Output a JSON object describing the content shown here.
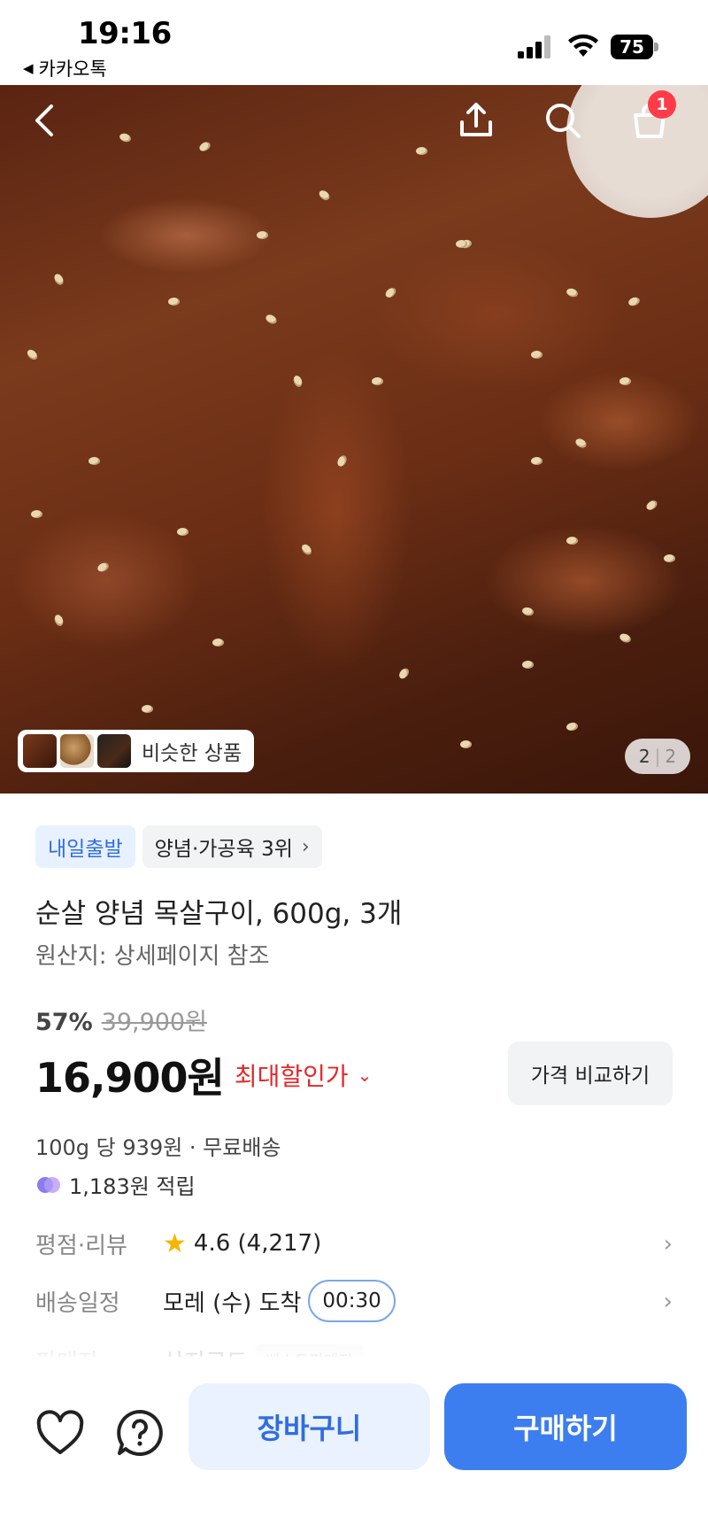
{
  "status_bar": {
    "time": "19:16",
    "back_app": "카카오톡",
    "battery": "75"
  },
  "hero": {
    "similar_label": "비슷한 상품",
    "page_current": "2",
    "page_total": "2",
    "cart_badge": "1"
  },
  "product": {
    "tag_shipping": "내일출발",
    "tag_ranking": "양념·가공육 3위",
    "title": "순살 양념 목살구이, 600g, 3개",
    "origin": "원산지: 상세페이지 참조",
    "discount": "57%",
    "original_price": "39,900원",
    "price": "16,900원",
    "max_discount_label": "최대할인가",
    "compare_label": "가격 비교하기",
    "unit_price": "100g 당 939원 · 무료배송",
    "points": "1,183원 적립"
  },
  "meta": {
    "rating_label": "평점·리뷰",
    "rating_value": "4.6 (4,217)",
    "delivery_label": "배송일정",
    "delivery_value": "모레 (수) 도착",
    "delivery_timer": "00:30",
    "seller_label": "판매자",
    "seller_value": "상지로드",
    "seller_badge": "베스트판매자"
  },
  "bottom": {
    "cart_label": "장바구니",
    "buy_label": "구매하기"
  },
  "colors": {
    "accent_blue": "#3c7ef0",
    "discount_red": "#e3292c",
    "star": "#f7b500"
  }
}
